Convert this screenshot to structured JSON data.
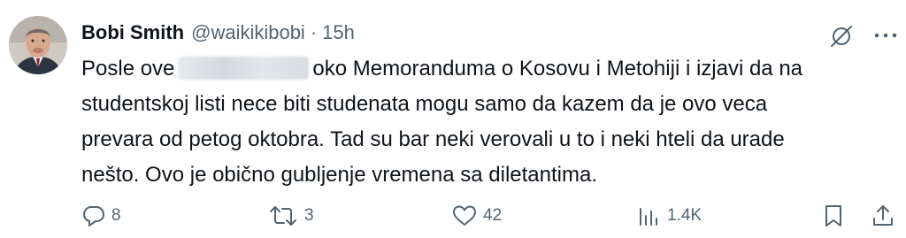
{
  "author": {
    "name": "Bobi Smith",
    "handle": "@waikikibobi",
    "separator": "·",
    "time": "15h"
  },
  "tweet": {
    "lines": [
      {
        "before": "Posle ove",
        "after": "oko Memoranduma o Kosovu i Metohiji i izjavi da na"
      },
      {
        "text": "studentskoj listi nece biti studenata mogu samo da kazem da je ovo veca"
      },
      {
        "text": "prevara od petog oktobra.  Tad su bar neki verovali u to i neki hteli da urade"
      },
      {
        "text": "nešto. Ovo je obično gubljenje vremena sa diletantima."
      }
    ]
  },
  "actions": {
    "replies": "8",
    "reposts": "3",
    "likes": "42",
    "views": "1.4K"
  },
  "icons": {
    "grok": "grok-icon",
    "more": "more-icon",
    "reply": "reply-icon",
    "repost": "repost-icon",
    "like": "heart-icon",
    "views": "views-icon",
    "bookmark": "bookmark-icon",
    "share": "share-icon"
  }
}
